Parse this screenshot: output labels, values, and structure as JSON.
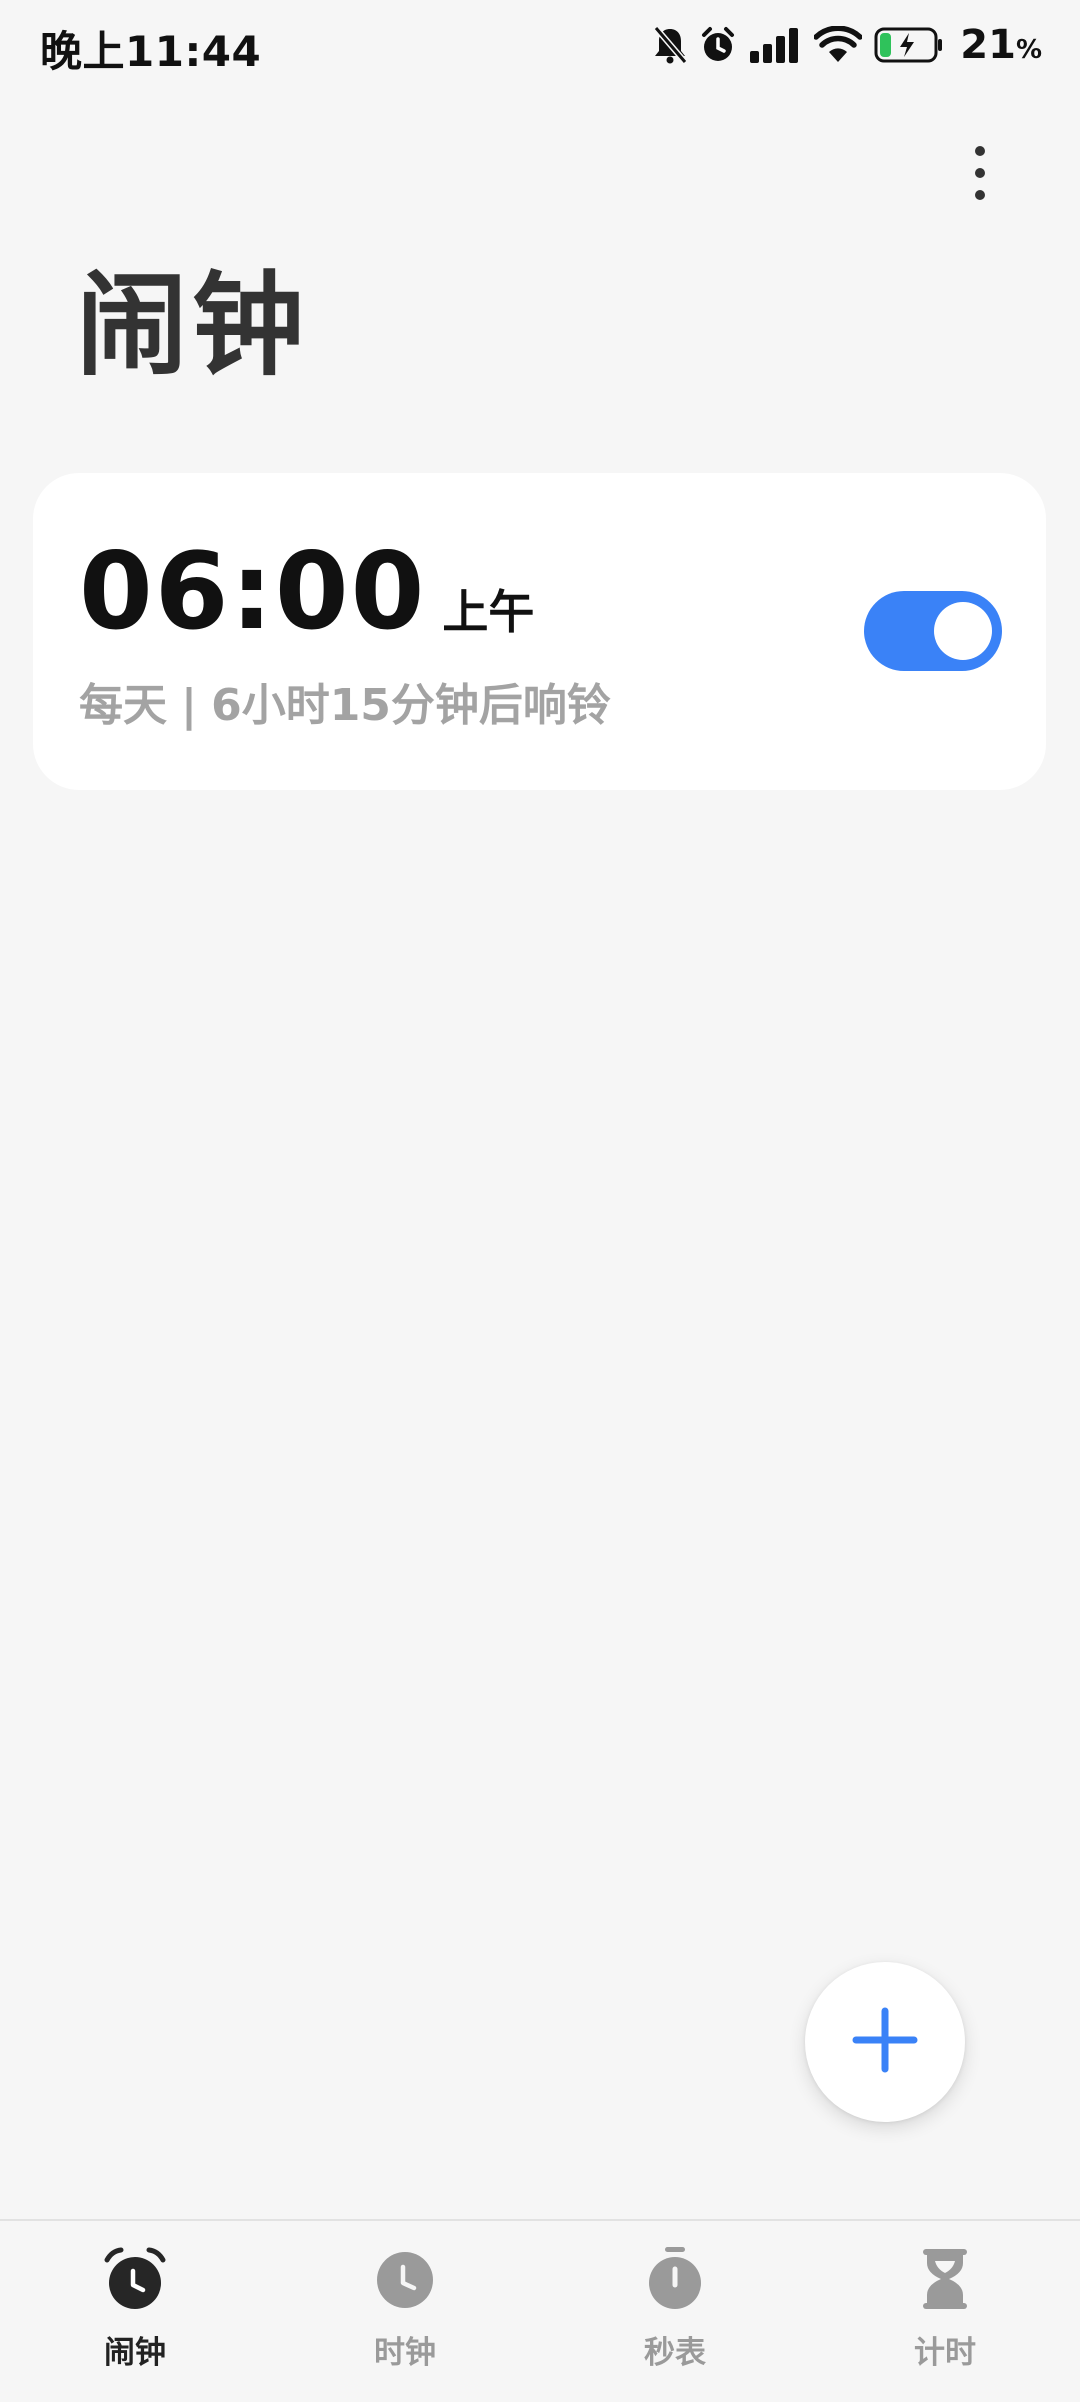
{
  "status_bar": {
    "time": "晚上11:44",
    "battery_percent": "21",
    "battery_unit": "%",
    "icons": [
      "mute-icon",
      "alarm-icon",
      "signal-icon",
      "wifi-icon",
      "battery-charging-icon"
    ]
  },
  "header": {
    "title": "闹钟",
    "more_icon": "more-vertical-icon"
  },
  "alarms": [
    {
      "time": "06:00",
      "ampm": "上午",
      "repeat": "每天",
      "separator": "|",
      "remaining": "6小时15分钟后响铃",
      "enabled": true
    }
  ],
  "fab": {
    "icon": "plus-icon"
  },
  "bottom_nav": {
    "items": [
      {
        "label": "闹钟",
        "icon": "alarm-clock-icon",
        "active": true
      },
      {
        "label": "时钟",
        "icon": "clock-icon",
        "active": false
      },
      {
        "label": "秒表",
        "icon": "stopwatch-icon",
        "active": false
      },
      {
        "label": "计时",
        "icon": "hourglass-icon",
        "active": false
      }
    ]
  },
  "colors": {
    "background": "#f6f6f6",
    "card": "#ffffff",
    "accent": "#3a82f7",
    "title_text": "#333333",
    "secondary_text": "#a3a3a3",
    "nav_inactive": "#9a9a9a"
  }
}
